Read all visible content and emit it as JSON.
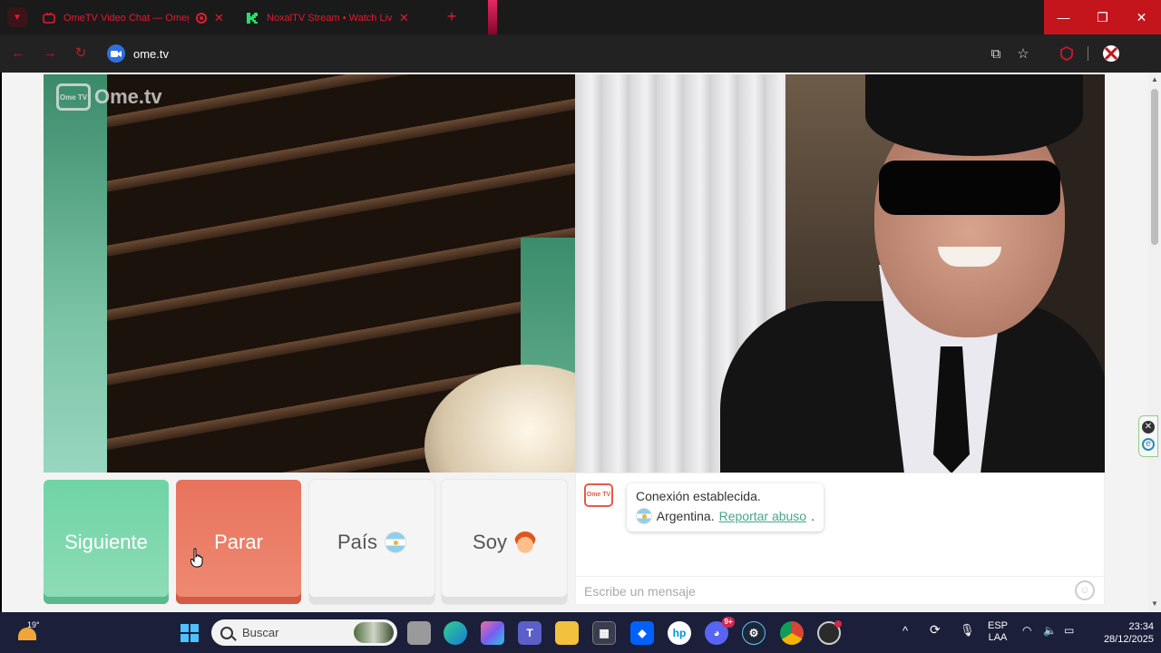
{
  "browser": {
    "tabs": [
      {
        "title": "OmeTV Video Chat — Omegle",
        "active": true
      },
      {
        "title": "NoxalTV Stream • Watch Live",
        "active": false
      }
    ],
    "url": "ome.tv",
    "accent": "#e01b2f"
  },
  "site": {
    "logo_badge": "Ome TV",
    "logo_text": "Ome.tv"
  },
  "controls": {
    "next_label": "Siguiente",
    "stop_label": "Parar",
    "country_label": "País",
    "gender_label": "Soy"
  },
  "chat": {
    "logo_badge": "Ome TV",
    "status": "Conexión establecida.",
    "country": "Argentina.",
    "report_link": "Reportar abuso",
    "report_suffix": ".",
    "input_placeholder": "Escribe un mensaje"
  },
  "taskbar": {
    "weather_temp": "19°",
    "search_label": "Buscar",
    "discord_badge": "9+",
    "lang_line1": "ESP",
    "lang_line2": "LAA",
    "time": "23:34",
    "date": "28/12/2025"
  }
}
